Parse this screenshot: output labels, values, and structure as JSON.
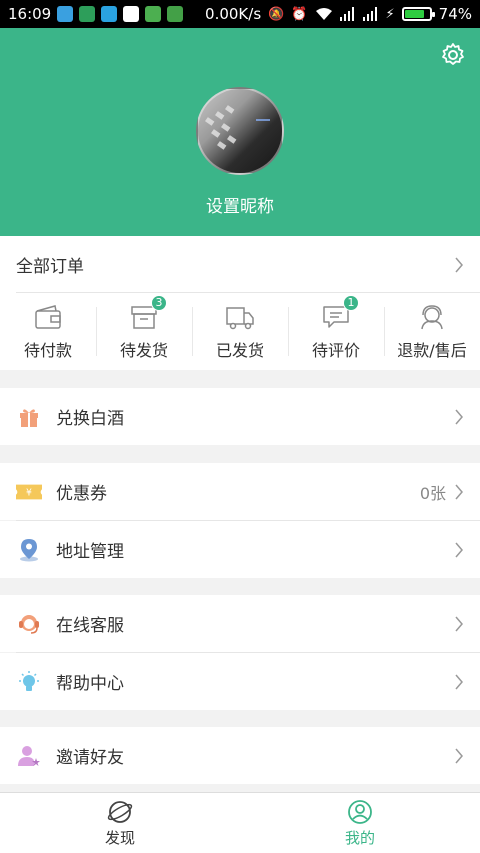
{
  "status_bar": {
    "time": "16:09",
    "network_speed": "0.00K/s",
    "battery": "74%",
    "battery_level": 0.74,
    "icons": [
      "app-icon",
      "app-icon",
      "telegram-icon",
      "app-icon",
      "sim-icon",
      "wechat-icon",
      "mute-icon",
      "alarm-icon",
      "wifi-icon",
      "signal-icon",
      "signal-icon",
      "charging-icon",
      "battery-icon"
    ]
  },
  "profile": {
    "nickname": "设置昵称",
    "header_color": "#3bb589"
  },
  "orders": {
    "all_label": "全部订单",
    "items": [
      {
        "label": "待付款",
        "icon": "wallet-icon",
        "badge": ""
      },
      {
        "label": "待发货",
        "icon": "package-box-icon",
        "badge": "3"
      },
      {
        "label": "已发货",
        "icon": "truck-icon",
        "badge": ""
      },
      {
        "label": "待评价",
        "icon": "comment-icon",
        "badge": "1"
      },
      {
        "label": "退款/售后",
        "icon": "refund-service-icon",
        "badge": ""
      }
    ]
  },
  "menu": {
    "exchange_liquor": "兑换白酒",
    "coupons": "优惠券",
    "coupon_count": "0张",
    "address": "地址管理",
    "customer_service": "在线客服",
    "help_center": "帮助中心",
    "invite_friends": "邀请好友"
  },
  "bottom_nav": {
    "discover": "发现",
    "mine": "我的",
    "active": "mine"
  }
}
